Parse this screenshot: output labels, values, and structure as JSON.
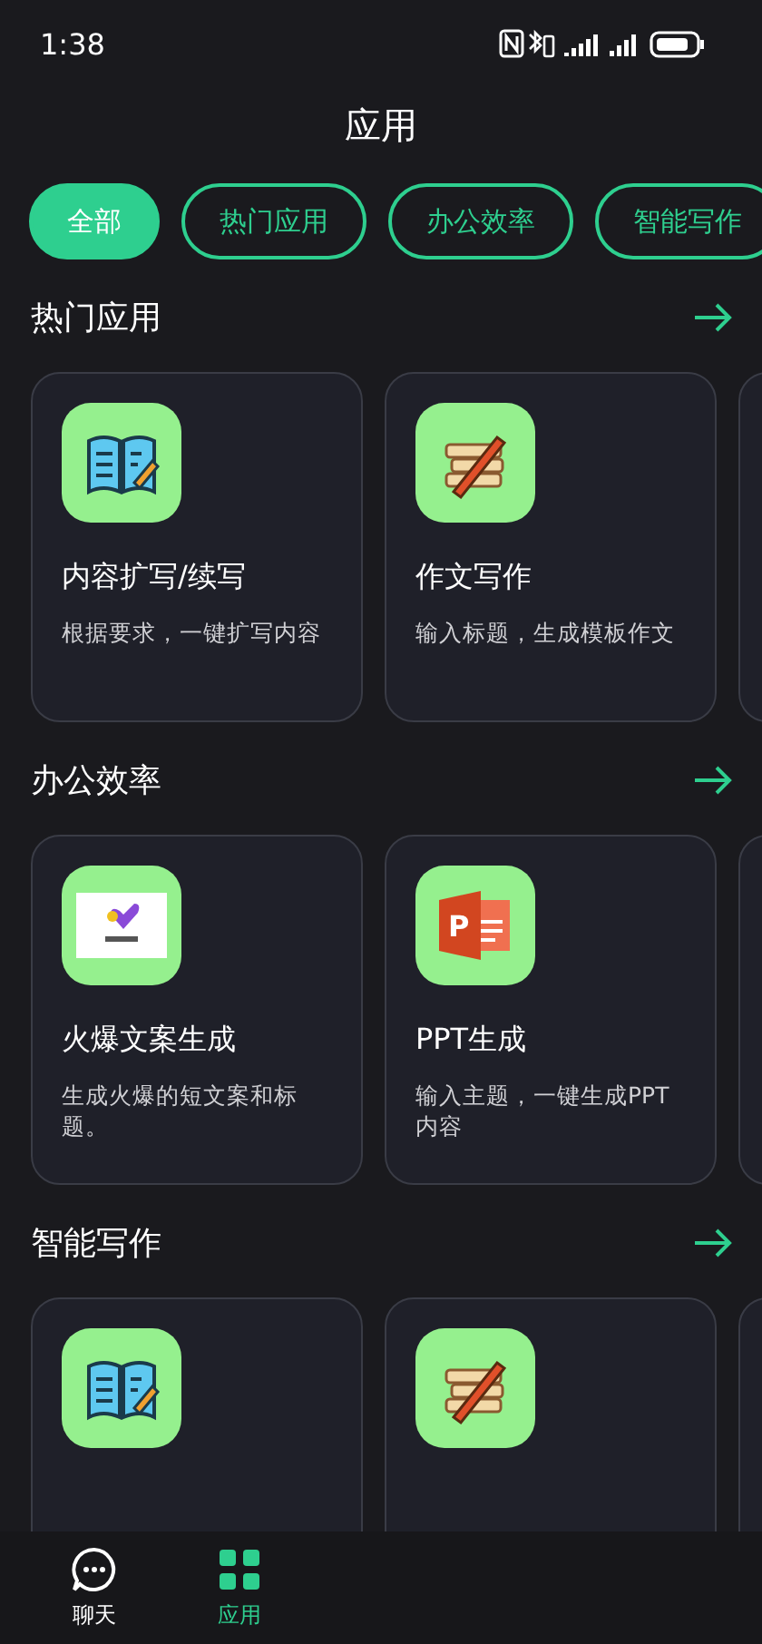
{
  "status_bar": {
    "time": "1:38"
  },
  "title": "应用",
  "chips": [
    {
      "label": "全部",
      "selected": true
    },
    {
      "label": "热门应用",
      "selected": false
    },
    {
      "label": "办公效率",
      "selected": false
    },
    {
      "label": "智能写作",
      "selected": false
    }
  ],
  "sections": [
    {
      "title": "热门应用",
      "apps": [
        {
          "kind": "book",
          "name": "内容扩写/续写",
          "desc": "根据要求，一键扩写内容"
        },
        {
          "kind": "books",
          "name": "作文写作",
          "desc": "输入标题，生成模板作文"
        }
      ]
    },
    {
      "title": "办公效率",
      "apps": [
        {
          "kind": "brand",
          "name": "火爆文案生成",
          "desc": "生成火爆的短文案和标题。"
        },
        {
          "kind": "ppt",
          "letter": "P",
          "name": "PPT生成",
          "desc": "输入主题，一键生成PPT内容"
        }
      ]
    },
    {
      "title": "智能写作",
      "apps": [
        {
          "kind": "book"
        },
        {
          "kind": "books"
        }
      ]
    }
  ],
  "tab_bar": [
    {
      "kind": "chat",
      "label": "聊天",
      "selected": false
    },
    {
      "kind": "grid",
      "label": "应用",
      "selected": true
    }
  ]
}
